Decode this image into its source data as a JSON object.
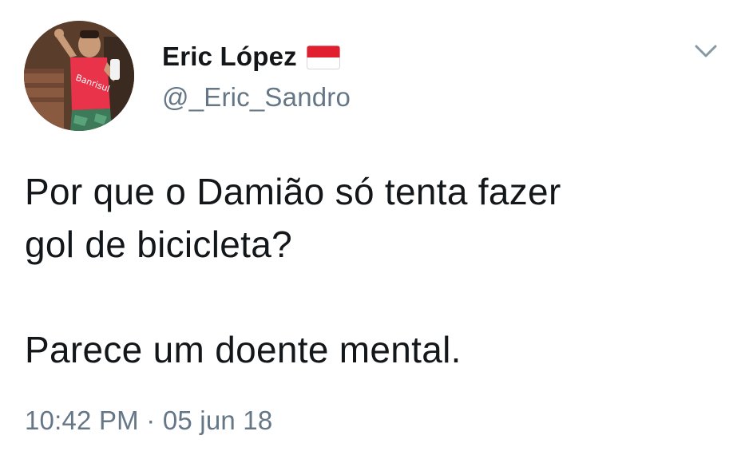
{
  "author": {
    "display_name": "Eric López",
    "handle": "@_Eric_Sandro",
    "flag_icon": "indonesia-flag-icon",
    "avatar_icon": "profile-photo-avatar"
  },
  "menu": {
    "icon": "chevron-down-icon"
  },
  "tweet": {
    "lines": [
      "Por que o Damião só tenta fazer",
      "gol de bicicleta?",
      "Parece um doente mental."
    ]
  },
  "meta": {
    "time": "10:42 PM",
    "separator": "·",
    "date": "05 jun 18"
  },
  "colors": {
    "text": "#14171a",
    "secondary": "#657786",
    "flag_red": "#e0202e",
    "background": "#ffffff"
  }
}
